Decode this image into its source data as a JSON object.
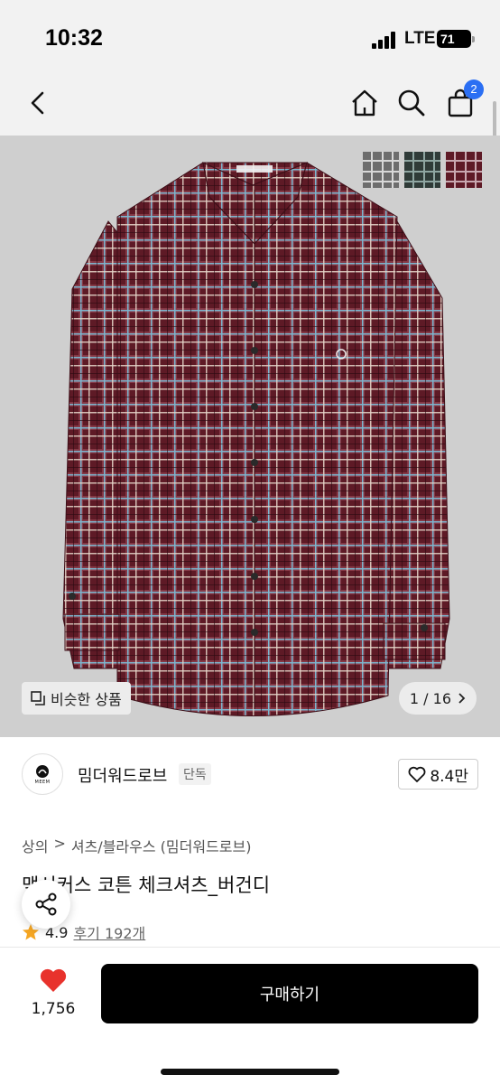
{
  "status_bar": {
    "time": "10:32",
    "network": "LTE",
    "battery": "71"
  },
  "nav": {
    "cart_badge": "2",
    "icons": [
      "back-icon",
      "home-icon",
      "search-icon",
      "cart-icon"
    ]
  },
  "hero": {
    "similar_label": "비슷한 상품",
    "image_counter": "1 / 16",
    "thumbnail_count": 3,
    "shirt_colors": {
      "base": "#5e1a26",
      "check_light": "#e8d9cc",
      "check_blue": "#7cb6cf"
    }
  },
  "brand": {
    "logo_text": "MEEM",
    "name": "밈더워드로브",
    "tag": "단독",
    "likes": "8.4만"
  },
  "breadcrumb": {
    "category": "상의",
    "separator": ">",
    "subcategory": "셔츠/블라우스 (밈더워드로브)"
  },
  "product": {
    "title": "맥시커스 코튼 체크셔츠_버건디"
  },
  "rating": {
    "score": "4.9",
    "reviews": "후기 192개"
  },
  "bottom": {
    "wish_count": "1,756",
    "buy_label": "구매하기"
  },
  "colors": {
    "accent_badge": "#2b6ff3",
    "heart": "#e8322c",
    "star": "#f5a623",
    "buy_bg": "#000000"
  }
}
